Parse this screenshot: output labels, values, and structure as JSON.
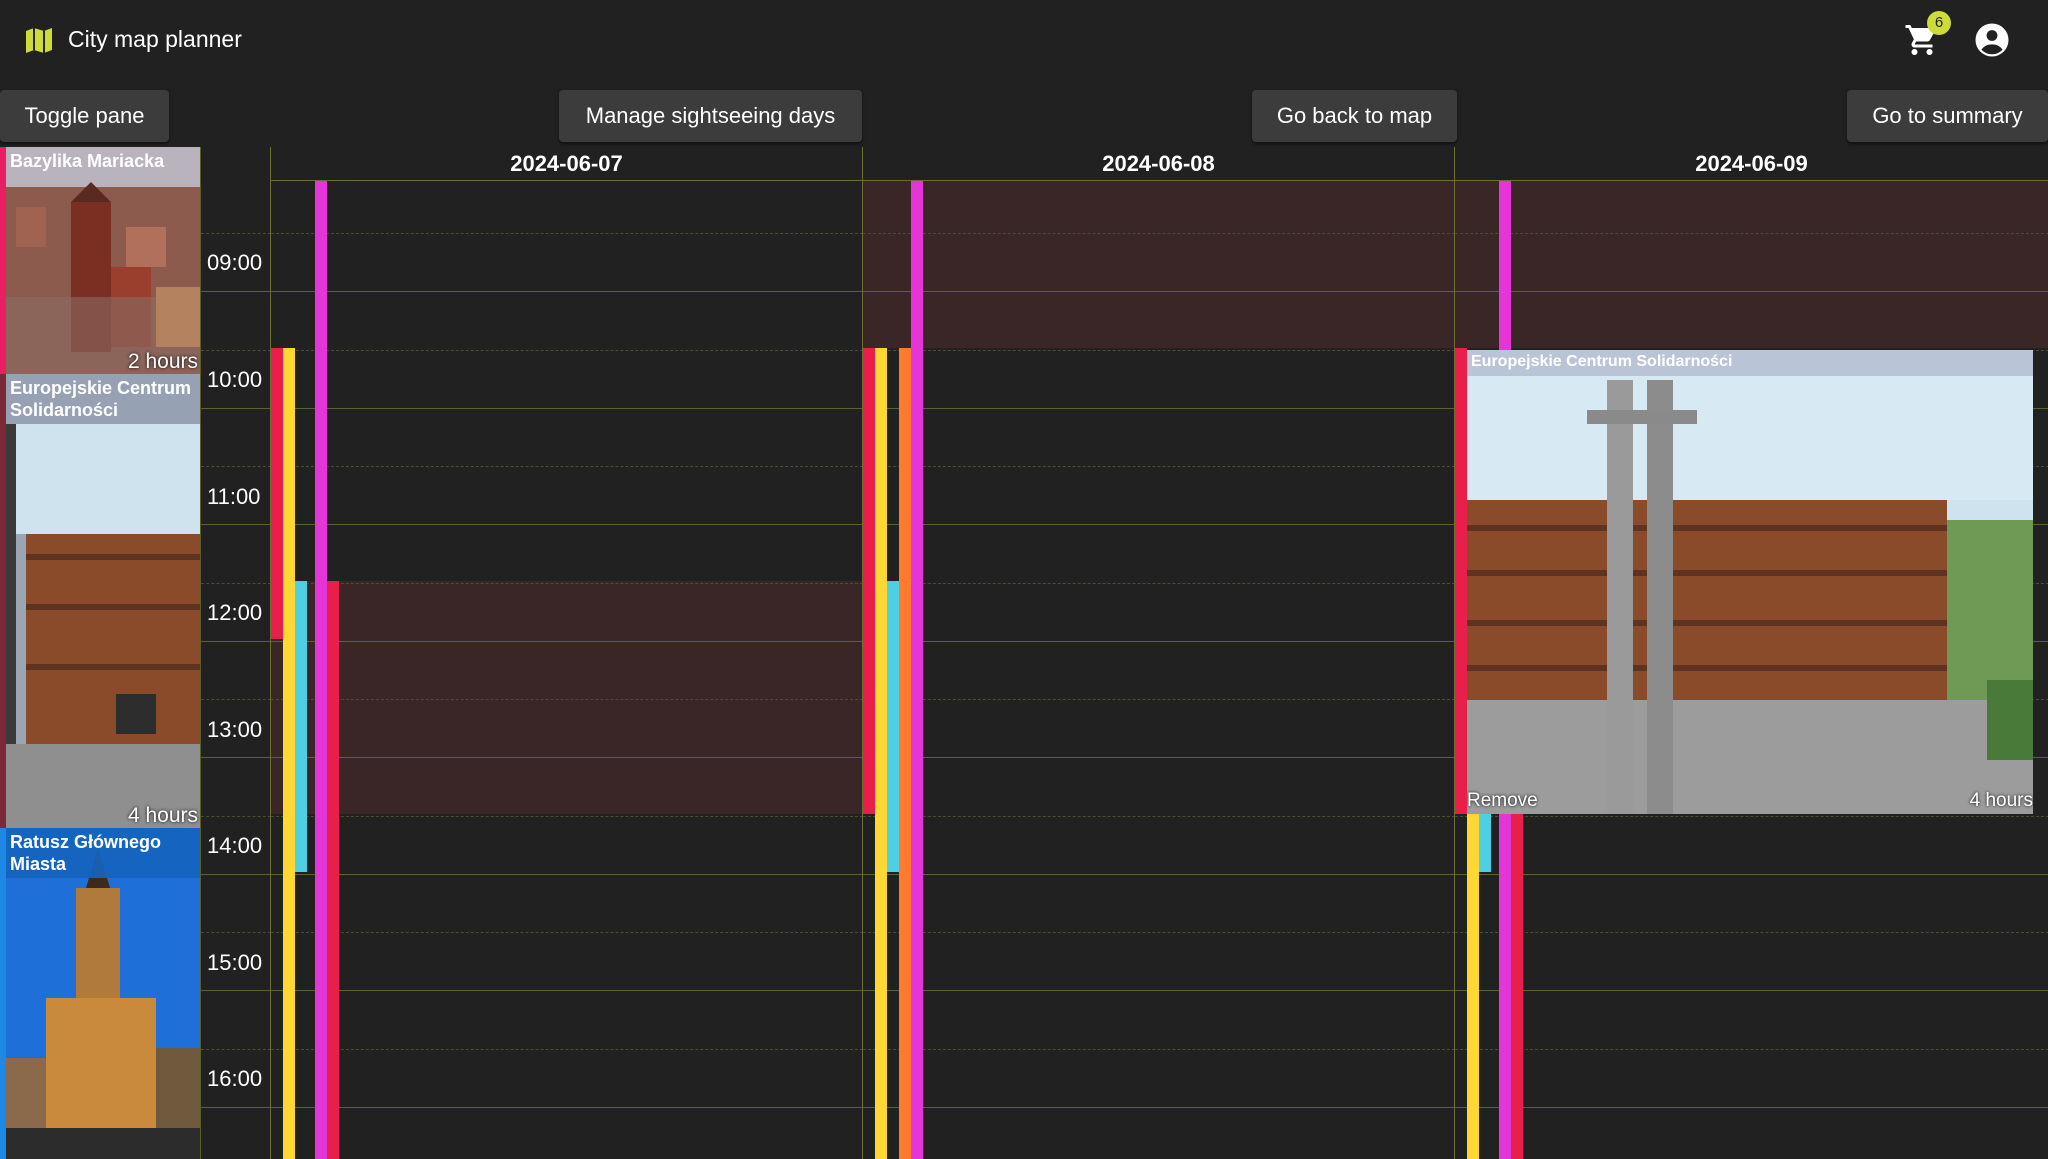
{
  "app": {
    "title": "City map planner",
    "cart_count": "6"
  },
  "toolbar": {
    "toggle_pane": "Toggle pane",
    "manage_days": "Manage sightseeing days",
    "back_to_map": "Go back to map",
    "summary": "Go to summary"
  },
  "pane": {
    "items": [
      {
        "title": "Bazylika Mariacka",
        "duration": "2 hours",
        "color": "#e91e63"
      },
      {
        "title": "Europejskie Centrum Solidarności",
        "duration": "4 hours",
        "color": "#7a2a36"
      },
      {
        "title": "Ratusz Głównego Miasta",
        "duration": "",
        "color": "#1e88e5"
      }
    ]
  },
  "calendar": {
    "days": [
      "2024-06-07",
      "2024-06-08",
      "2024-06-09"
    ],
    "hours": [
      "09:00",
      "10:00",
      "11:00",
      "12:00",
      "13:00",
      "14:00",
      "15:00",
      "16:00"
    ],
    "event": {
      "title": "Europejskie Centrum Solidarności",
      "remove": "Remove",
      "duration": "4 hours"
    }
  },
  "colors": {
    "background": "#212121",
    "blocked": "#3b2627",
    "grid_line": "#5d6233",
    "badge": "#cddc39",
    "bar_red": "#e91e4a",
    "bar_yellow": "#fdd835",
    "bar_magenta": "#e535d9",
    "bar_cyan": "#4dd0e1",
    "bar_orange": "#ff7a2f"
  },
  "icons": [
    "map-icon",
    "cart-icon",
    "account-icon"
  ]
}
